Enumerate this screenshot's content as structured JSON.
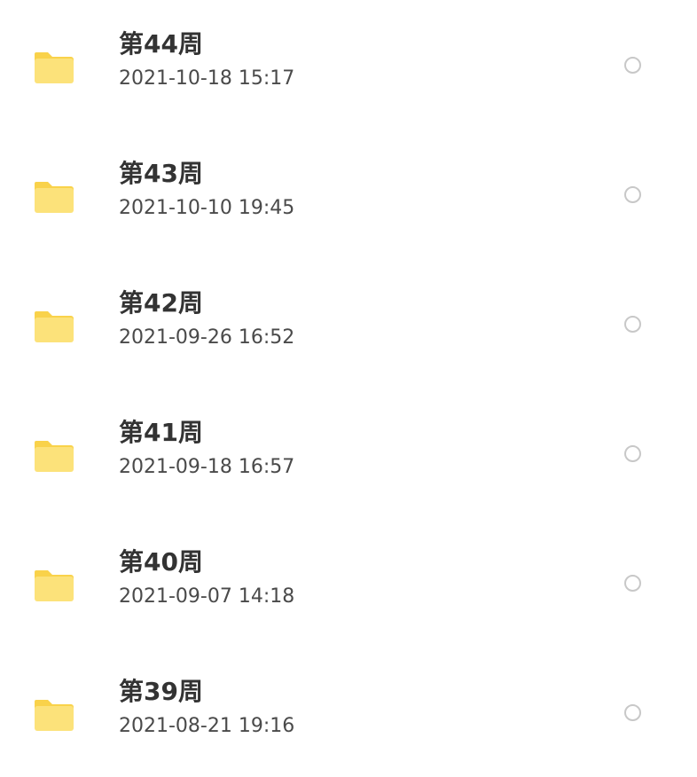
{
  "folders": [
    {
      "name": "第44周",
      "date": "2021-10-18 15:17",
      "selected": false
    },
    {
      "name": "第43周",
      "date": "2021-10-10 19:45",
      "selected": false
    },
    {
      "name": "第42周",
      "date": "2021-09-26 16:52",
      "selected": false
    },
    {
      "name": "第41周",
      "date": "2021-09-18 16:57",
      "selected": false
    },
    {
      "name": "第40周",
      "date": "2021-09-07 14:18",
      "selected": false
    },
    {
      "name": "第39周",
      "date": "2021-08-21 19:16",
      "selected": false
    }
  ],
  "colors": {
    "folder_back": "#F9D24A",
    "folder_front": "#FCE27A",
    "title_text": "#333333",
    "date_text": "#4A4A4A",
    "radio_border": "#C8C8C8"
  },
  "icons": {
    "folder": "folder-icon",
    "select": "radio-circle-icon"
  }
}
